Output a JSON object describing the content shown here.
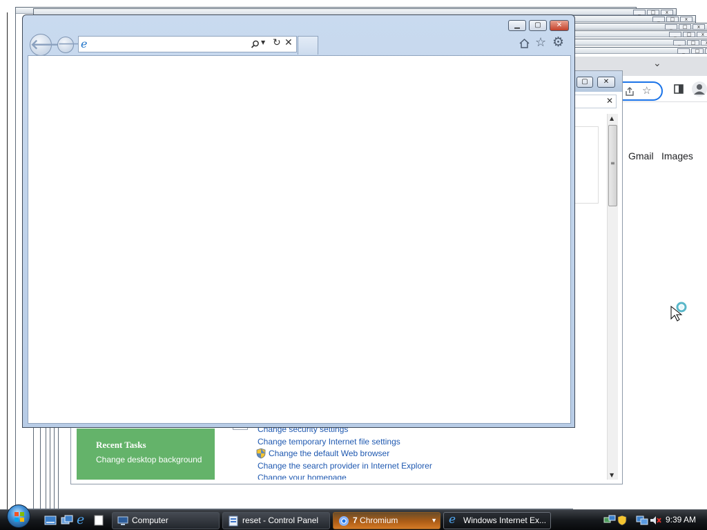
{
  "ie_window": {
    "title": "",
    "address_value": "",
    "caption_buttons": {
      "minimize": "▁",
      "restore": "▢",
      "close": "✕"
    }
  },
  "chromium_window": {
    "links": {
      "gmail": "Gmail",
      "images": "Images"
    }
  },
  "control_panel": {
    "sidebar": {
      "heading": "Recent Tasks",
      "item": "Change desktop background"
    },
    "links": [
      "Change security settings",
      "Change temporary Internet file settings",
      "Change the default Web browser",
      "Change the search provider in Internet Explorer",
      "Change your homepage"
    ]
  },
  "taskbar": {
    "buttons": [
      {
        "label": "Computer",
        "icon": "computer-icon"
      },
      {
        "label": "reset - Control Panel",
        "icon": "control-panel-icon"
      },
      {
        "count": "7",
        "label": "Chromium",
        "icon": "chromium-icon"
      },
      {
        "label": "Windows Internet Ex...",
        "icon": "ie-icon"
      }
    ],
    "clock": "9:39 AM"
  },
  "colors": {
    "taskbar": "#16191d",
    "active_taskbar": "#ad5d16",
    "link": "#1e58b0",
    "recent_tasks_bg": "#64b36a",
    "ie_frame": "#b8cce6"
  }
}
